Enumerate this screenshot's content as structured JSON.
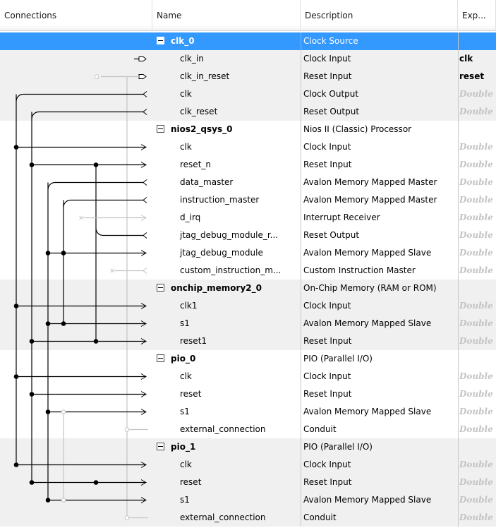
{
  "columns": {
    "connections": "Connections",
    "name": "Name",
    "description": "Description",
    "export": "Exp..."
  },
  "rows": [
    {
      "type": "component",
      "name": "clk_0",
      "description": "Clock Source",
      "export": "",
      "selected": true
    },
    {
      "type": "interface",
      "name": "clk_in",
      "description": "Clock Input",
      "export": "clk",
      "export_style": "strong"
    },
    {
      "type": "interface",
      "name": "clk_in_reset",
      "description": "Reset Input",
      "export": "reset",
      "export_style": "strong"
    },
    {
      "type": "interface",
      "name": "clk",
      "description": "Clock Output",
      "export": "Double",
      "export_style": "hint"
    },
    {
      "type": "interface",
      "name": "clk_reset",
      "description": "Reset Output",
      "export": "Double",
      "export_style": "hint"
    },
    {
      "type": "component",
      "name": "nios2_qsys_0",
      "description": "Nios II (Classic) Processor",
      "export": ""
    },
    {
      "type": "interface",
      "name": "clk",
      "description": "Clock Input",
      "export": "Double",
      "export_style": "hint"
    },
    {
      "type": "interface",
      "name": "reset_n",
      "description": "Reset Input",
      "export": "Double",
      "export_style": "hint"
    },
    {
      "type": "interface",
      "name": "data_master",
      "description": "Avalon Memory Mapped Master",
      "export": "Double",
      "export_style": "hint"
    },
    {
      "type": "interface",
      "name": "instruction_master",
      "description": "Avalon Memory Mapped Master",
      "export": "Double",
      "export_style": "hint"
    },
    {
      "type": "interface",
      "name": "d_irq",
      "description": "Interrupt Receiver",
      "export": "Double",
      "export_style": "hint"
    },
    {
      "type": "interface",
      "name": "jtag_debug_module_r...",
      "description": "Reset Output",
      "export": "Double",
      "export_style": "hint"
    },
    {
      "type": "interface",
      "name": "jtag_debug_module",
      "description": "Avalon Memory Mapped Slave",
      "export": "Double",
      "export_style": "hint"
    },
    {
      "type": "interface",
      "name": "custom_instruction_m...",
      "description": "Custom Instruction Master",
      "export": "Double",
      "export_style": "hint"
    },
    {
      "type": "component",
      "name": "onchip_memory2_0",
      "description": "On-Chip Memory (RAM or ROM)",
      "export": ""
    },
    {
      "type": "interface",
      "name": "clk1",
      "description": "Clock Input",
      "export": "Double",
      "export_style": "hint"
    },
    {
      "type": "interface",
      "name": "s1",
      "description": "Avalon Memory Mapped Slave",
      "export": "Double",
      "export_style": "hint"
    },
    {
      "type": "interface",
      "name": "reset1",
      "description": "Reset Input",
      "export": "Double",
      "export_style": "hint"
    },
    {
      "type": "component",
      "name": "pio_0",
      "description": "PIO (Parallel I/O)",
      "export": ""
    },
    {
      "type": "interface",
      "name": "clk",
      "description": "Clock Input",
      "export": "Double",
      "export_style": "hint"
    },
    {
      "type": "interface",
      "name": "reset",
      "description": "Reset Input",
      "export": "Double",
      "export_style": "hint"
    },
    {
      "type": "interface",
      "name": "s1",
      "description": "Avalon Memory Mapped Slave",
      "export": "Double",
      "export_style": "hint"
    },
    {
      "type": "interface",
      "name": "external_connection",
      "description": "Conduit",
      "export": "Double",
      "export_style": "hint"
    },
    {
      "type": "component",
      "name": "pio_1",
      "description": "PIO (Parallel I/O)",
      "export": ""
    },
    {
      "type": "interface",
      "name": "clk",
      "description": "Clock Input",
      "export": "Double",
      "export_style": "hint"
    },
    {
      "type": "interface",
      "name": "reset",
      "description": "Reset Input",
      "export": "Double",
      "export_style": "hint"
    },
    {
      "type": "interface",
      "name": "s1",
      "description": "Avalon Memory Mapped Slave",
      "export": "Double",
      "export_style": "hint"
    },
    {
      "type": "interface",
      "name": "external_connection",
      "description": "Conduit",
      "export": "Double",
      "export_style": "hint"
    }
  ],
  "colors": {
    "selection": "#3399ff",
    "band": "#f0f0f0",
    "wire_active": "#000000",
    "wire_inactive": "#c4c4c4",
    "hint_text": "#c4c4c4"
  },
  "icons": {
    "collapse": "minus-box-icon",
    "port_in": "arrow-in-icon",
    "port_out": "arrow-out-icon",
    "connection_node": "dot-icon"
  }
}
